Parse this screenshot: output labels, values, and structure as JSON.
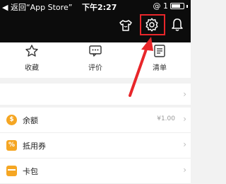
{
  "status_bar": {
    "back_label": "◀ 返回“App Store”",
    "signal": "●●●●○",
    "time": "下午2:27",
    "right_text": "@ 1",
    "battery_label": "battery"
  },
  "header": {
    "icons": [
      "shirt-icon",
      "gear-icon",
      "bell-icon"
    ],
    "highlight_color": "#e8262a"
  },
  "features": [
    {
      "label": "收藏",
      "icon": "star-icon"
    },
    {
      "label": "评价",
      "icon": "comment-icon"
    },
    {
      "label": "清单",
      "icon": "list-icon"
    }
  ],
  "list": [
    {
      "label": "余额",
      "icon": "coin-icon",
      "value": "¥1.00"
    },
    {
      "label": "抵用券",
      "icon": "coupon-icon",
      "value": ""
    },
    {
      "label": "卡包",
      "icon": "wallet-icon",
      "value": ""
    }
  ],
  "colors": {
    "accent": "#f5a623",
    "header_bg": "#0c0c0c",
    "annotation": "#e8262a"
  }
}
